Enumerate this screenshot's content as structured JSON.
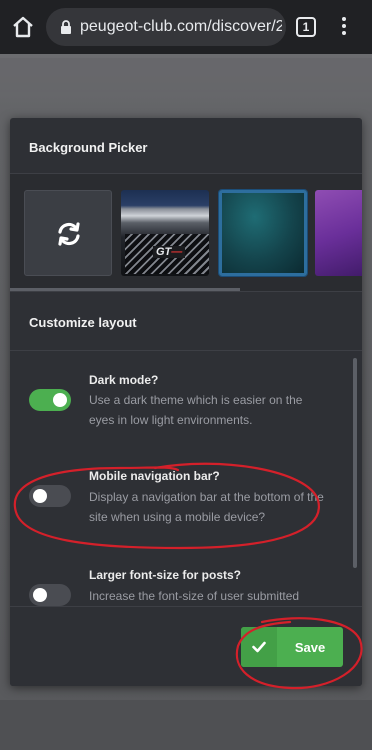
{
  "browser": {
    "url": "peugeot-club.com/discover/2",
    "tab_count": "1",
    "icons": [
      "home-icon",
      "lock-icon",
      "tabs-icon",
      "overflow-menu-icon"
    ]
  },
  "modal": {
    "background_picker": {
      "title": "Background Picker",
      "tiles": [
        {
          "kind": "refresh",
          "icon": "refresh-icon"
        },
        {
          "kind": "image",
          "badge_text": "GT"
        },
        {
          "kind": "image",
          "selected": true
        },
        {
          "kind": "image"
        }
      ]
    },
    "customize": {
      "title": "Customize layout",
      "options": [
        {
          "title": "Dark mode?",
          "description": "Use a dark theme which is easier on the eyes in low light environments.",
          "enabled": true
        },
        {
          "title": "Mobile navigation bar?",
          "description": "Display a navigation bar at the bottom of the site when using a mobile device?",
          "enabled": false
        },
        {
          "title": "Larger font-size for posts?",
          "description": "Increase the font-size of user submitted",
          "enabled": false
        }
      ]
    },
    "save_label": "Save"
  },
  "colors": {
    "accent_green": "#4caf50",
    "modal_bg": "#2e3035",
    "annotation_red": "#d4202a",
    "selected_border": "#2d6e9e"
  }
}
